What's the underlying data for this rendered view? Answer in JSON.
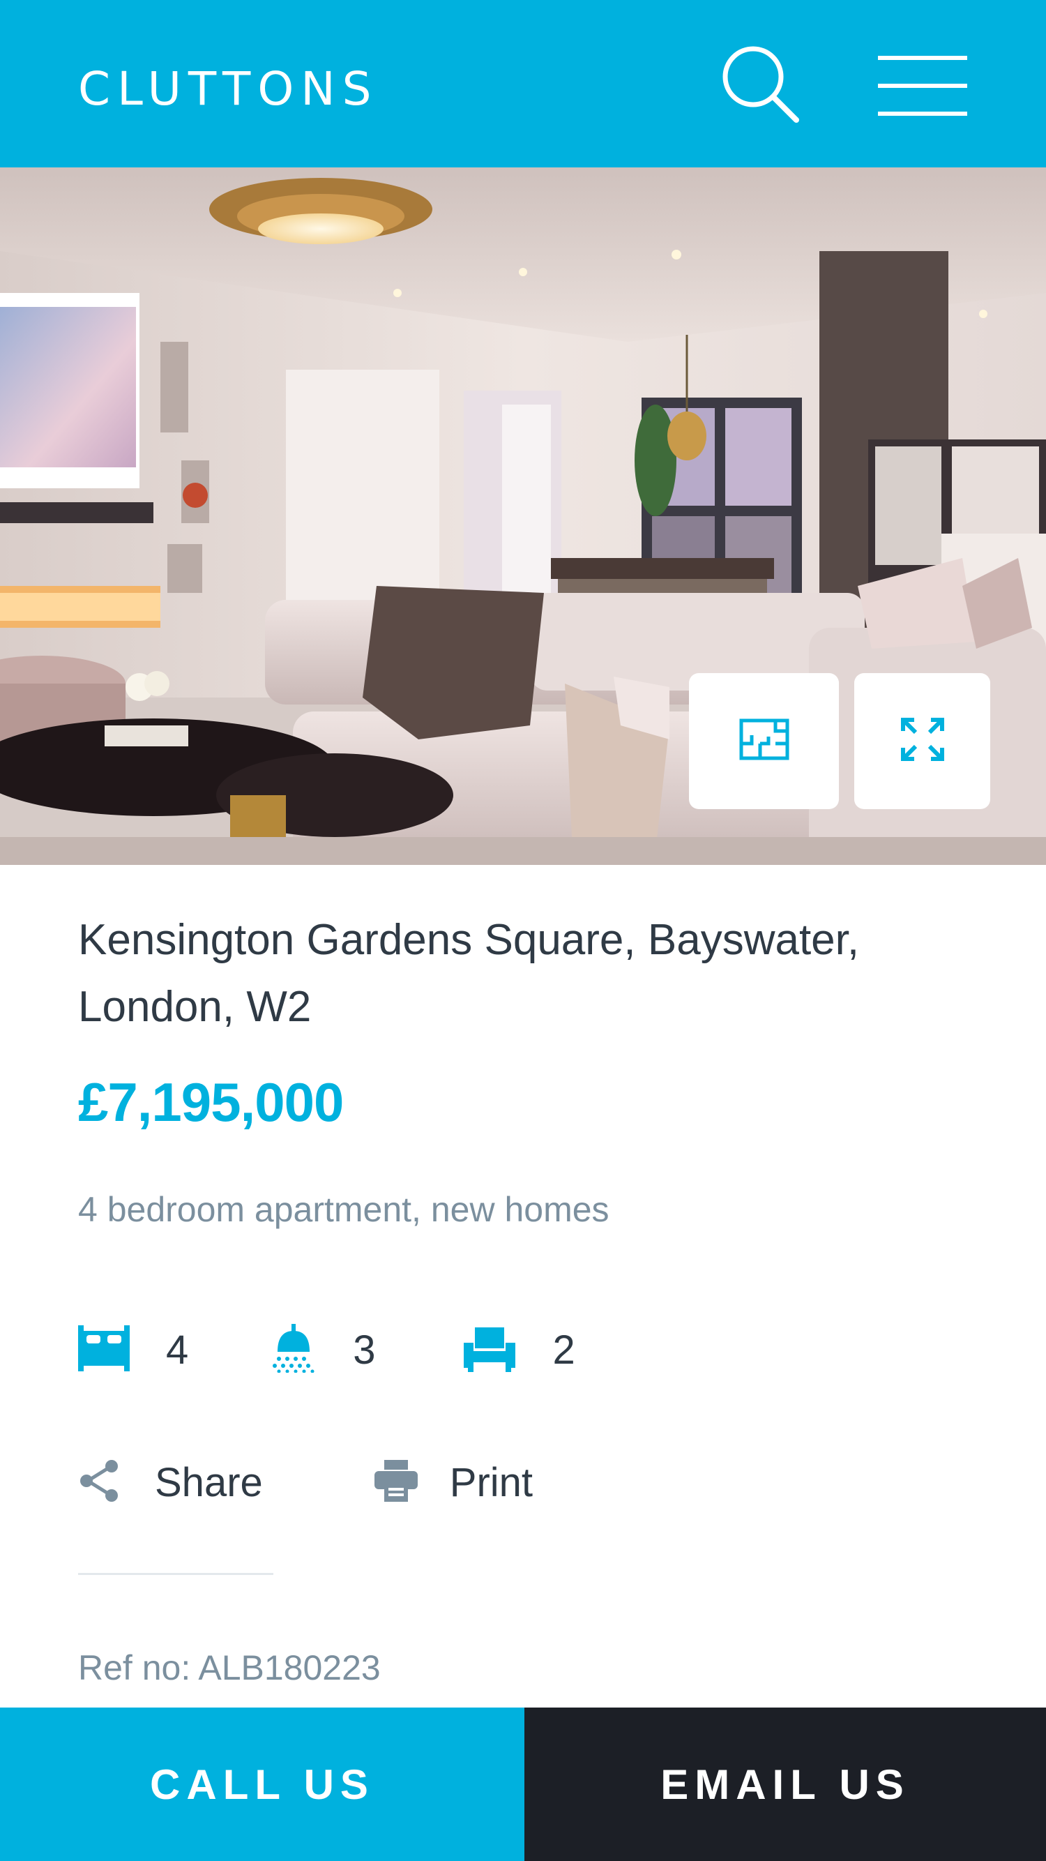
{
  "header": {
    "logo_text": "CLUTTONS",
    "icons": {
      "search": "search-icon",
      "menu": "hamburger-menu-icon"
    },
    "background_color": "#00b1de"
  },
  "hero": {
    "image_description_icon": "photo",
    "buttons": {
      "floorplan_icon": "floorplan-icon",
      "expand_icon": "expand-icon"
    }
  },
  "property": {
    "address": "Kensington Gardens Square, Bayswater, London, W2",
    "price": "£7,195,000",
    "subtitle": "4 bedroom apartment, new homes",
    "bedrooms": "4",
    "bathrooms": "3",
    "receptions": "2",
    "ref": "Ref no: ALB180223"
  },
  "actions": {
    "share_label": "Share",
    "print_label": "Print"
  },
  "cta": {
    "call_label": "CALL US",
    "email_label": "EMAIL US"
  },
  "colors": {
    "accent": "#00b1de",
    "dark": "#1c1f26",
    "text": "#2f3a45",
    "muted": "#7b8f9e"
  }
}
